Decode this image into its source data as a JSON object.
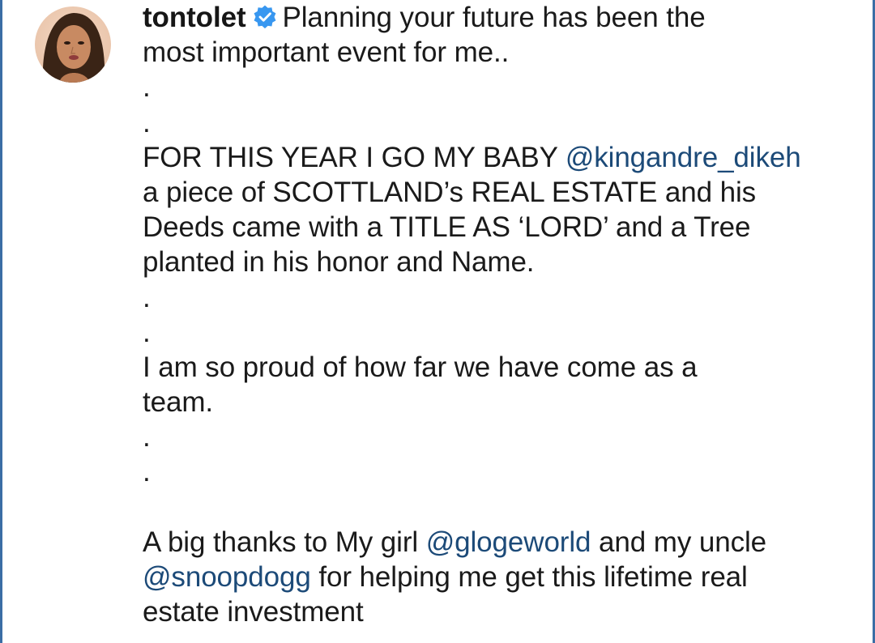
{
  "post": {
    "username": "tontolet",
    "verified": true,
    "avatar": "profile-photo",
    "caption_lines": [
      "Planning your future has been the",
      "most important event for me..",
      ".",
      ".",
      "FOR THIS YEAR I GO MY BABY ",
      "@kingandre_dikeh",
      "a piece of SCOTTLAND’s REAL ESTATE and his",
      "Deeds came with a TITLE AS ‘LORD’ and a Tree",
      "planted in his honor and Name.",
      ".",
      ".",
      "I am so proud of how far we have come as a",
      "team.",
      ".",
      ".",
      "A big thanks to My girl ",
      "@glogeworld",
      " and my uncle",
      "@snoopdogg",
      " for helping me get this lifetime real",
      "estate investment"
    ]
  },
  "colors": {
    "text": "#1a1a1a",
    "mention": "#1c4a78",
    "verified_badge": "#3897f0",
    "frame_border": "#3b6ea5"
  }
}
